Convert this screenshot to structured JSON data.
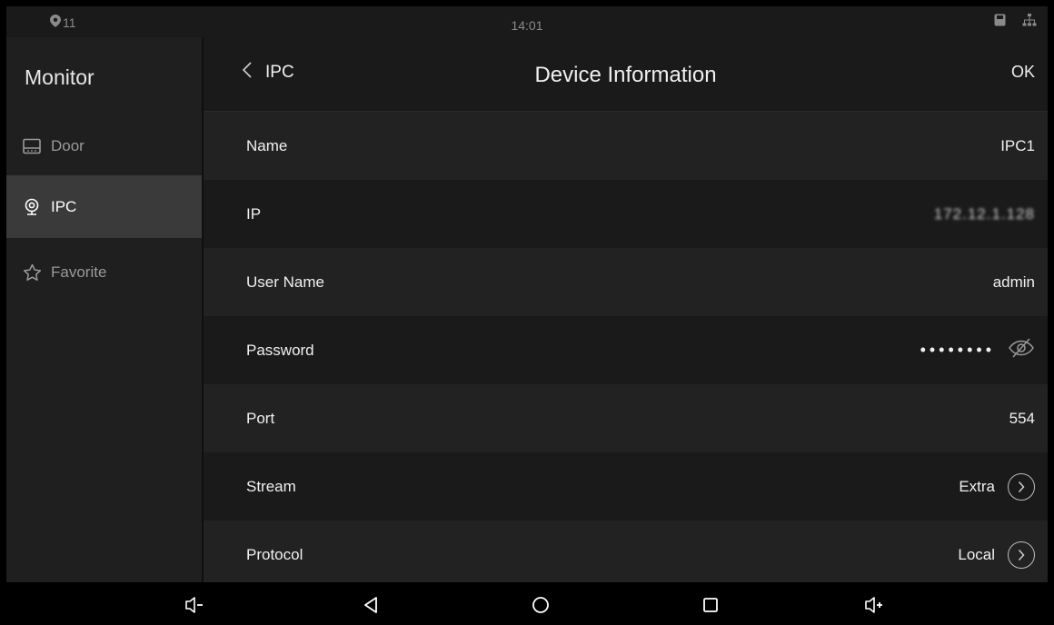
{
  "status_bar": {
    "notification_count": "11",
    "time": "14:01"
  },
  "sidebar": {
    "title": "Monitor",
    "items": [
      {
        "label": "Door",
        "icon": "door-icon"
      },
      {
        "label": "IPC",
        "icon": "camera-icon",
        "active": true
      },
      {
        "label": "Favorite",
        "icon": "star-icon"
      }
    ]
  },
  "header": {
    "back_label": "IPC",
    "title": "Device Information",
    "ok_label": "OK"
  },
  "fields": {
    "name": {
      "label": "Name",
      "value": "IPC1"
    },
    "ip": {
      "label": "IP",
      "value": "172.12.1.128"
    },
    "user_name": {
      "label": "User Name",
      "value": "admin"
    },
    "password": {
      "label": "Password",
      "value": "••••••••"
    },
    "port": {
      "label": "Port",
      "value": "554"
    },
    "stream": {
      "label": "Stream",
      "value": "Extra"
    },
    "protocol": {
      "label": "Protocol",
      "value": "Local"
    }
  },
  "colors": {
    "background": "#161616",
    "active_nav": "#3a3a3a",
    "text": "#f0f0f0"
  }
}
